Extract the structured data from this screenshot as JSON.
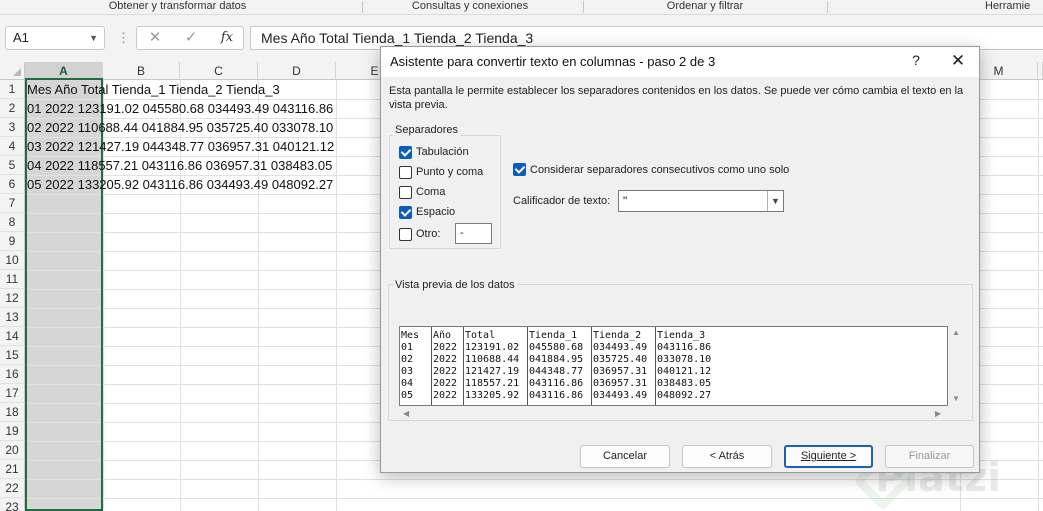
{
  "ribbon": {
    "groups": [
      "Obtener y transformar datos",
      "Consultas y conexiones",
      "Ordenar y filtrar",
      "Herramie"
    ]
  },
  "formula_bar": {
    "name_box": "A1",
    "fx_label": "fx",
    "formula": "Mes Año Total Tienda_1 Tienda_2 Tienda_3"
  },
  "sheet": {
    "columns": [
      "A",
      "B",
      "C",
      "D",
      "E",
      "M"
    ],
    "rows": [
      "1",
      "2",
      "3",
      "4",
      "5",
      "6",
      "7",
      "8",
      "9",
      "10",
      "11",
      "12",
      "13",
      "14",
      "15",
      "16",
      "17",
      "18",
      "19",
      "20",
      "21",
      "22",
      "23"
    ],
    "cells": [
      "Mes Año Total Tienda_1 Tienda_2 Tienda_3",
      "01 2022 123191.02 045580.68 034493.49 043116.86",
      "02 2022 110688.44 041884.95 035725.40 033078.10",
      "03 2022 121427.19 044348.77 036957.31 040121.12",
      "04 2022 118557.21 043116.86 036957.31 038483.05",
      "05 2022 133205.92 043116.86 034493.49 048092.27"
    ]
  },
  "dialog": {
    "title": "Asistente para convertir texto en columnas - paso 2 de 3",
    "help": "?",
    "close": "✕",
    "description": "Esta pantalla le permite establecer los separadores contenidos en los datos. Se puede ver cómo cambia el texto en la vista previa.",
    "separators_label": "Separadores",
    "separators": [
      {
        "label": "Tabulación",
        "checked": true
      },
      {
        "label": "Punto y coma",
        "checked": false
      },
      {
        "label": "Coma",
        "checked": false
      },
      {
        "label": "Espacio",
        "checked": true
      },
      {
        "label": "Otro:",
        "checked": false
      }
    ],
    "other_value": "-",
    "consecutive_label": "Considerar separadores consecutivos como uno solo",
    "consecutive_checked": true,
    "qualifier_label": "Calificador de texto:",
    "qualifier_value": "\"",
    "preview_label": "Vista previa de los datos",
    "preview_rows": [
      [
        "Mes",
        "Año",
        "Total",
        "Tienda_1",
        "Tienda_2",
        "Tienda_3"
      ],
      [
        "01",
        "2022",
        "123191.02",
        "045580.68",
        "034493.49",
        "043116.86"
      ],
      [
        "02",
        "2022",
        "110688.44",
        "041884.95",
        "035725.40",
        "033078.10"
      ],
      [
        "03",
        "2022",
        "121427.19",
        "044348.77",
        "036957.31",
        "040121.12"
      ],
      [
        "04",
        "2022",
        "118557.21",
        "043116.86",
        "036957.31",
        "038483.05"
      ],
      [
        "05",
        "2022",
        "133205.92",
        "043116.86",
        "034493.49",
        "048092.27"
      ]
    ],
    "buttons": {
      "cancel": "Cancelar",
      "back": "< Atrás",
      "next": "Siguiente >",
      "finish": "Finalizar"
    }
  },
  "watermark": "Platzi"
}
